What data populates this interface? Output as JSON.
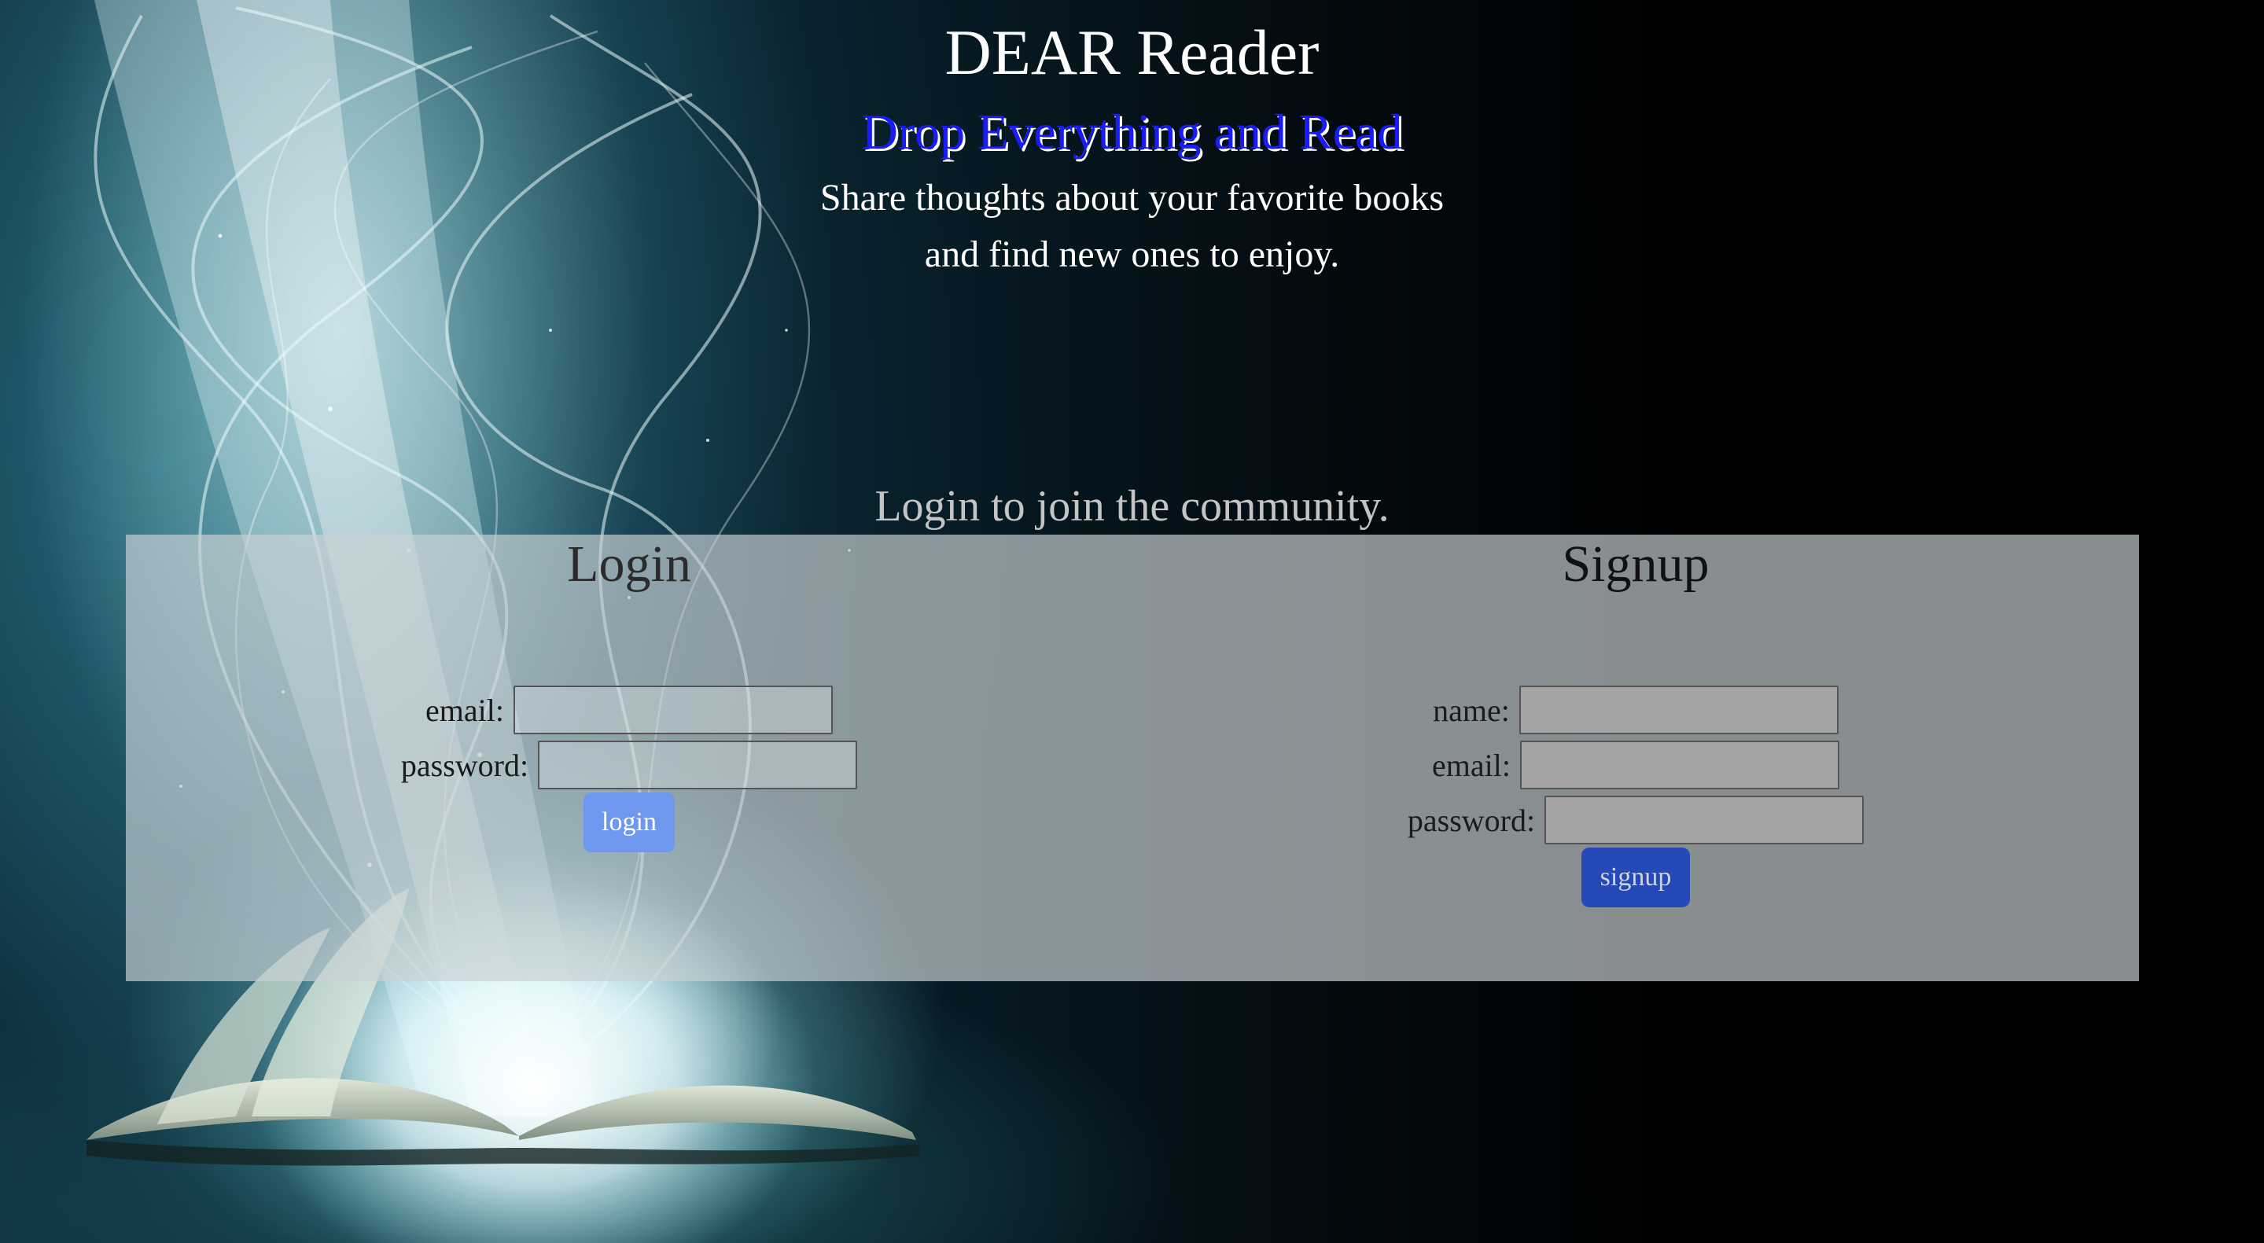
{
  "header": {
    "title": "DEAR Reader",
    "tagline": "Drop Everything and Read",
    "subtitle_line1": "Share thoughts about your favorite books",
    "subtitle_line2": "and find new ones to enjoy."
  },
  "cta": "Login to join the community.",
  "login": {
    "heading": "Login",
    "email_label": "email:",
    "email_value": "",
    "password_label": "password:",
    "password_value": "",
    "button_label": "login"
  },
  "signup": {
    "heading": "Signup",
    "name_label": "name:",
    "name_value": "",
    "email_label": "email:",
    "email_value": "",
    "password_label": "password:",
    "password_value": "",
    "button_label": "signup"
  },
  "colors": {
    "tagline": "#1a1aff",
    "login_button": "#6e98f0",
    "signup_button": "#2549b7",
    "panel": "#c8d2d4"
  }
}
